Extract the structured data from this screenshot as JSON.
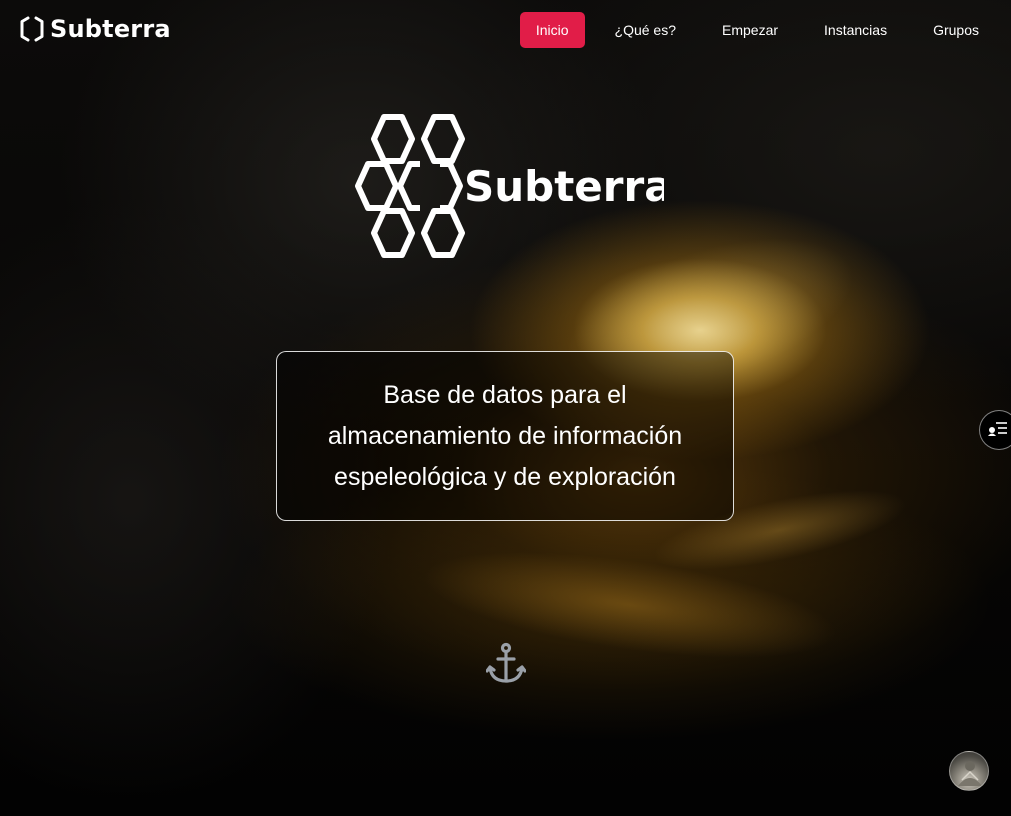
{
  "brand": {
    "name": "Subterra",
    "icon": "hexagon-logo-icon"
  },
  "nav": {
    "items": [
      {
        "label": "Inicio",
        "active": true
      },
      {
        "label": "¿Qué es?",
        "active": false
      },
      {
        "label": "Empezar",
        "active": false
      },
      {
        "label": "Instancias",
        "active": false
      },
      {
        "label": "Grupos",
        "active": false
      }
    ]
  },
  "hero": {
    "logo_text": "Subterra",
    "logo_icon": "hexagon-cluster-logo-icon",
    "tagline": "Base de datos para el almacenamiento de información espeleológica y de exploración",
    "scroll_icon": "anchor-icon"
  },
  "side_button": {
    "icon": "user-list-icon"
  },
  "avatar": {
    "icon": "user-avatar"
  },
  "colors": {
    "accent": "#e11d48",
    "text": "#ffffff",
    "anchor": "#9aa0a8"
  }
}
